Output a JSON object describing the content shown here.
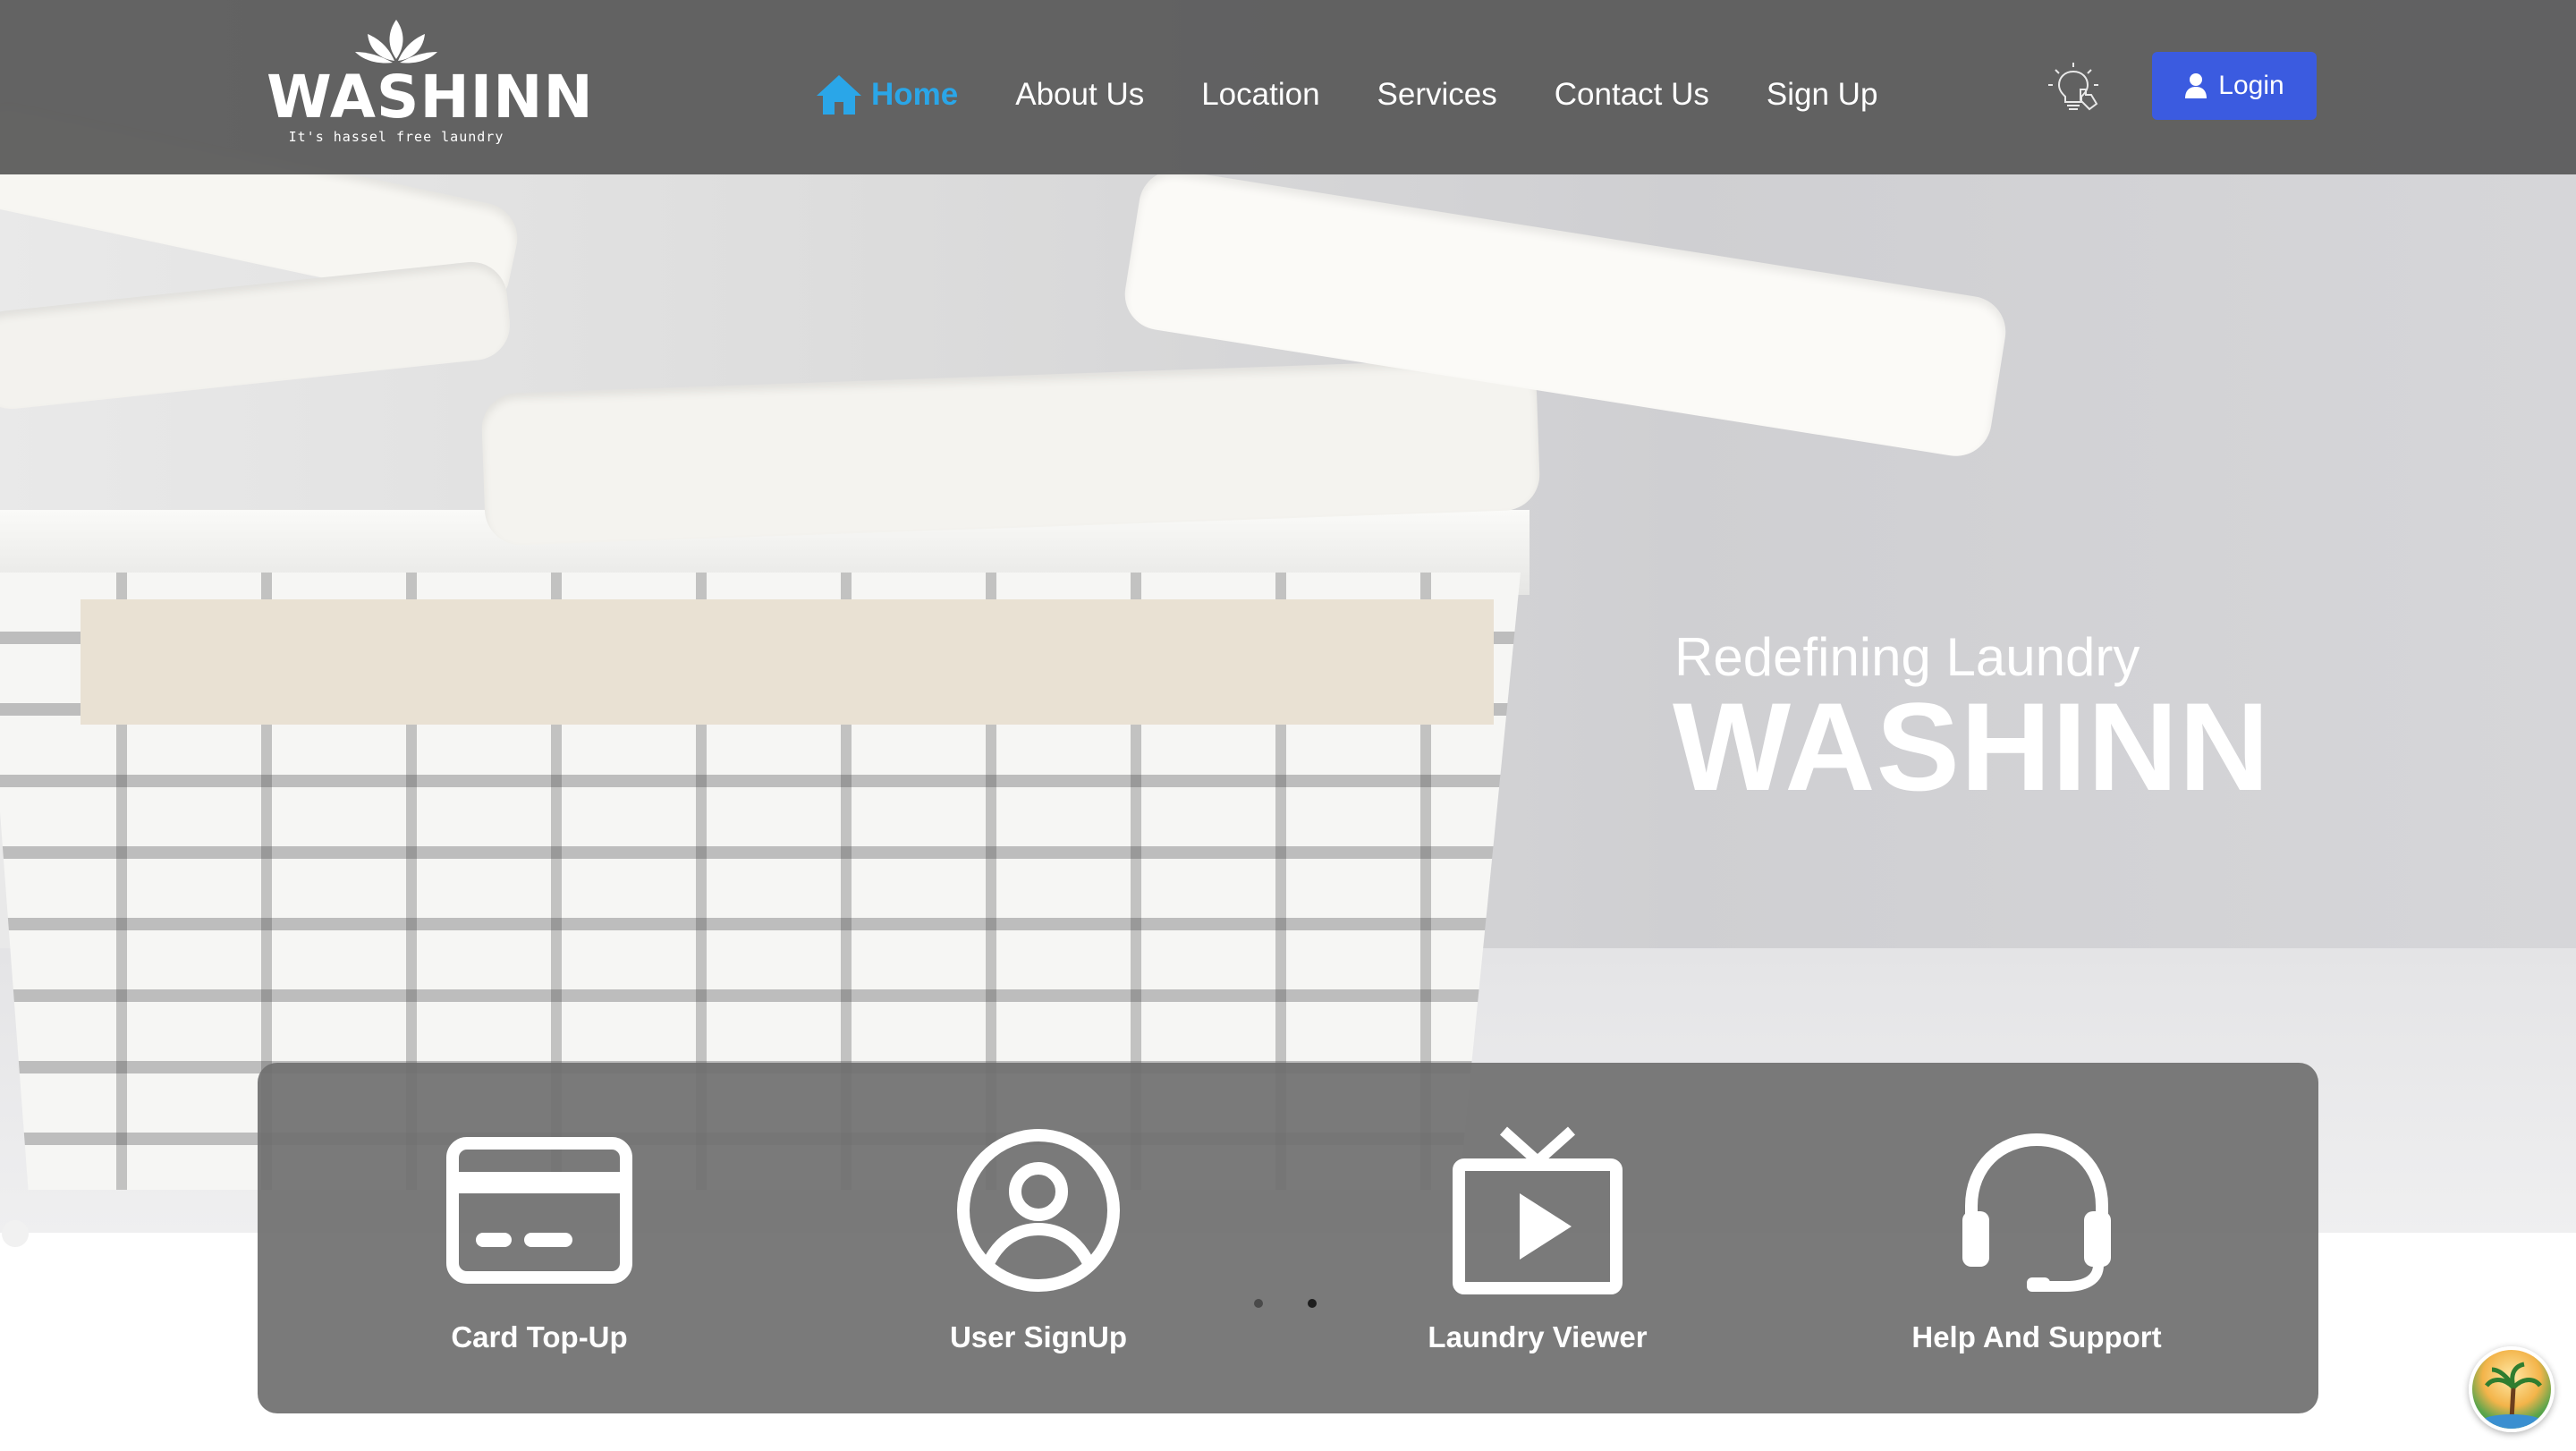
{
  "brand": {
    "name": "WASHINN",
    "tagline": "It's hassel free laundry"
  },
  "nav": {
    "items": [
      {
        "label": "Home",
        "active": true
      },
      {
        "label": "About Us"
      },
      {
        "label": "Location"
      },
      {
        "label": "Services"
      },
      {
        "label": "Contact Us"
      },
      {
        "label": "Sign Up"
      }
    ]
  },
  "header": {
    "theme_toggle_icon": "lightbulb-icon",
    "login_label": "Login",
    "login_icon": "user-icon"
  },
  "hero": {
    "subtitle": "Redefining Laundry",
    "title": "WASHINN"
  },
  "services": [
    {
      "label": "Card Top-Up",
      "icon": "credit-card-icon"
    },
    {
      "label": "User SignUp",
      "icon": "user-circle-icon"
    },
    {
      "label": "Laundry Viewer",
      "icon": "tv-play-icon"
    },
    {
      "label": "Help And Support",
      "icon": "headset-icon"
    }
  ],
  "carousel": {
    "total_slides": 2,
    "active_slide": 2
  },
  "colors": {
    "nav_active": "#2aa6e8",
    "login_button": "#3b5be0",
    "navbar_bg": "#585858",
    "panel_bg": "#707070"
  }
}
